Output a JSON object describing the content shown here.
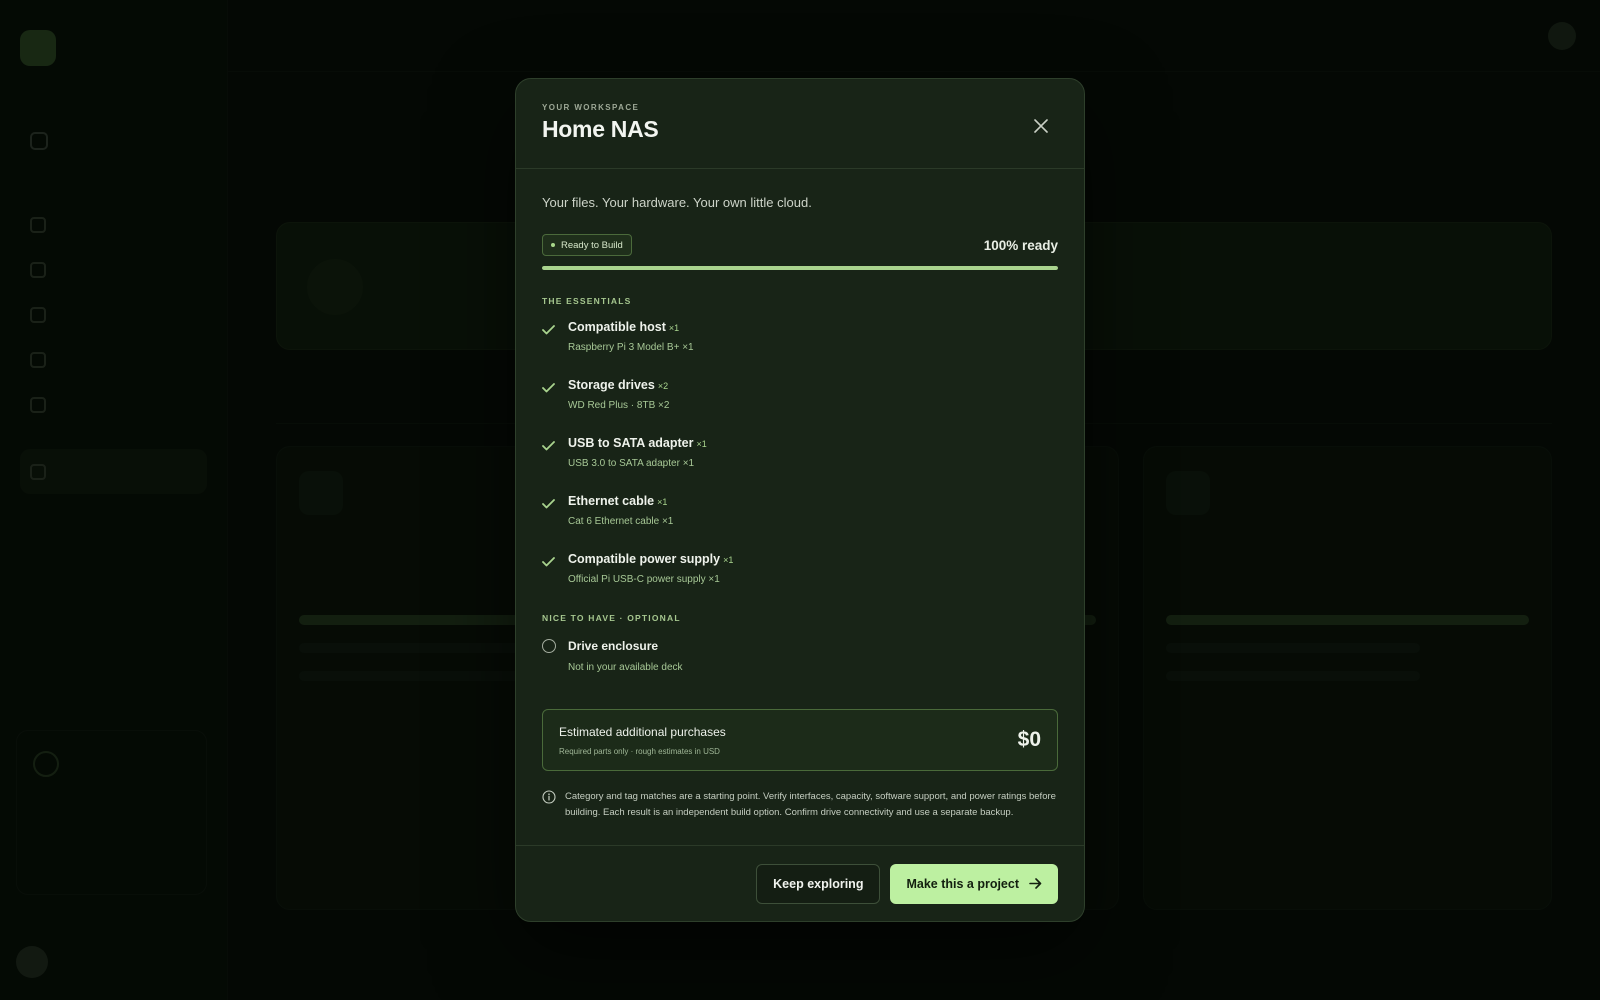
{
  "modal": {
    "kicker": "YOUR WORKSPACE",
    "title": "Home NAS",
    "tagline": "Your files. Your hardware. Your own little cloud.",
    "status": {
      "badge": "Ready to Build",
      "ready_text": "100% ready",
      "progress_percent": 100
    },
    "essentials": {
      "label": "THE ESSENTIALS",
      "items": [
        {
          "title": "Compatible host",
          "qty": "×1",
          "detail": "Raspberry Pi 3 Model B+ ×1"
        },
        {
          "title": "Storage drives",
          "qty": "×2",
          "detail": "WD Red Plus · 8TB ×2"
        },
        {
          "title": "USB to SATA adapter",
          "qty": "×1",
          "detail": "USB 3.0 to SATA adapter ×1"
        },
        {
          "title": "Ethernet cable",
          "qty": "×1",
          "detail": "Cat 6 Ethernet cable ×1"
        },
        {
          "title": "Compatible power supply",
          "qty": "×1",
          "detail": "Official Pi USB-C power supply ×1"
        }
      ]
    },
    "optional": {
      "label": "NICE TO HAVE · OPTIONAL",
      "items": [
        {
          "title": "Drive enclosure",
          "detail": "Not in your available deck"
        }
      ]
    },
    "estimate": {
      "title": "Estimated additional purchases",
      "subtitle": "Required parts only · rough estimates in USD",
      "value": "$0"
    },
    "notice": "Category and tag matches are a starting point. Verify interfaces, capacity, software support, and power ratings before building. Each result is an independent build option. Confirm drive connectivity and use a separate backup.",
    "buttons": {
      "secondary": "Keep exploring",
      "primary": "Make this a project"
    }
  },
  "icons": {
    "close": "close-icon",
    "check": "check-icon",
    "info": "info-icon",
    "arrow": "arrow-right-icon"
  },
  "colors": {
    "accent": "#a9d48e",
    "primary_button": "#bdf0a1",
    "modal_bg": "#182417"
  }
}
